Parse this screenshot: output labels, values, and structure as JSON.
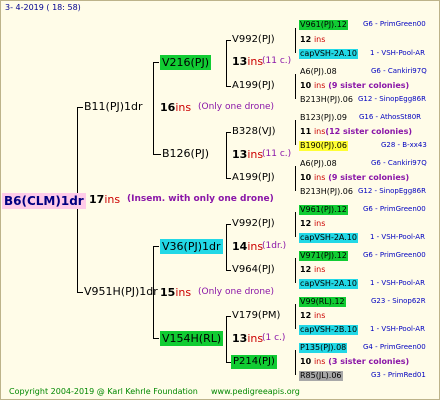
{
  "header": "3-  4-2019 ( 18: 58)",
  "footer": {
    "copyright": "Copyright 2004-2019 @ Karl Kehrle Foundation",
    "site": "www.pedigreeapis.org"
  },
  "root": {
    "label": "B6(CLM)1dr",
    "count": "17",
    "ins": "ins",
    "note": "(Insem. with only one drone)"
  },
  "gen1": [
    {
      "label": "B11(PJ)1dr",
      "count": "16",
      "ins": "ins",
      "note": "(Only one drone)"
    },
    {
      "label": "V951H(PJ)1dr",
      "count": "15",
      "ins": "ins",
      "note": "(Only one drone)"
    }
  ],
  "gen2": [
    {
      "label": "V216(PJ)",
      "count": "13",
      "ins": "ins",
      "note": "(11 c.)"
    },
    {
      "label": "B126(PJ)",
      "count": "13",
      "ins": "ins",
      "note": "(11 c.)"
    },
    {
      "label": "V36(PJ)1dr",
      "count": "14",
      "ins": "ins",
      "note": "(1dr.)"
    },
    {
      "label": "V154H(RL)",
      "count": "13",
      "ins": "ins",
      "note": "(1 c.)"
    }
  ],
  "gen3": [
    {
      "label": "V992(PJ)",
      "count": "12",
      "ins": "ins",
      "note": ""
    },
    {
      "label": "A199(PJ)",
      "count": "10",
      "ins": "ins",
      "note": "(9 sister colonies)"
    },
    {
      "label": "B328(VJ)",
      "count": "11",
      "ins": "ins",
      "note": "(12 sister colonies)"
    },
    {
      "label": "A199(PJ)",
      "count": "10",
      "ins": "ins",
      "note": "(9 sister colonies)"
    },
    {
      "label": "V992(PJ)",
      "count": "12",
      "ins": "ins",
      "note": ""
    },
    {
      "label": "V964(PJ)",
      "count": "12",
      "ins": "ins",
      "note": ""
    },
    {
      "label": "V179(PM)",
      "count": "12",
      "ins": "ins",
      "note": ""
    },
    {
      "label": "P214(PJ)",
      "count": "10",
      "ins": "ins",
      "note": "(3 sister colonies)"
    }
  ],
  "gen4": [
    {
      "label": "V961(PJ).12",
      "right": "G6 - PrimGreen00"
    },
    {
      "label": "capVSH-2A.10",
      "right": "1 - VSH-Pool-AR"
    },
    {
      "label": "A6(PJ).08",
      "right": "G6 - Cankiri97Q"
    },
    {
      "label": "B213H(PJ).06",
      "right": "G12 - SinopEgg86R"
    },
    {
      "label": "B123(PJ).09",
      "right": "G16 - AthosSt80R"
    },
    {
      "label": "B190(PJ).06",
      "right": "G28 - B-xx43"
    },
    {
      "label": "A6(PJ).08",
      "right": "G6 - Cankiri97Q"
    },
    {
      "label": "B213H(PJ).06",
      "right": "G12 - SinopEgg86R"
    },
    {
      "label": "V961(PJ).12",
      "right": "G6 - PrimGreen00"
    },
    {
      "label": "capVSH-2A.10",
      "right": "1 - VSH-Pool-AR"
    },
    {
      "label": "V971(PJ).12",
      "right": "G6 - PrimGreen00"
    },
    {
      "label": "capVSH-2A.10",
      "right": "1 - VSH-Pool-AR"
    },
    {
      "label": "V99(RL).12",
      "right": "G23 - Sinop62R"
    },
    {
      "label": "capVSH-2B.10",
      "right": "1 - VSH-Pool-AR"
    },
    {
      "label": "P135(PJ).08",
      "right": "G4 - PrimGreen00"
    },
    {
      "label": "R85(JL).06",
      "right": "G3 - PrimRed01"
    }
  ],
  "colors": {
    "background": "#fffce8",
    "root_bg": "#ffcbe8",
    "green": "#11cc33",
    "cyan": "#22d8e6",
    "yellow": "#ffff33",
    "gray": "#a8a8a8",
    "ins_red": "#cc0000",
    "note_purple": "#8a16a8",
    "link_blue": "#0000c0",
    "footer_green": "#008800"
  }
}
